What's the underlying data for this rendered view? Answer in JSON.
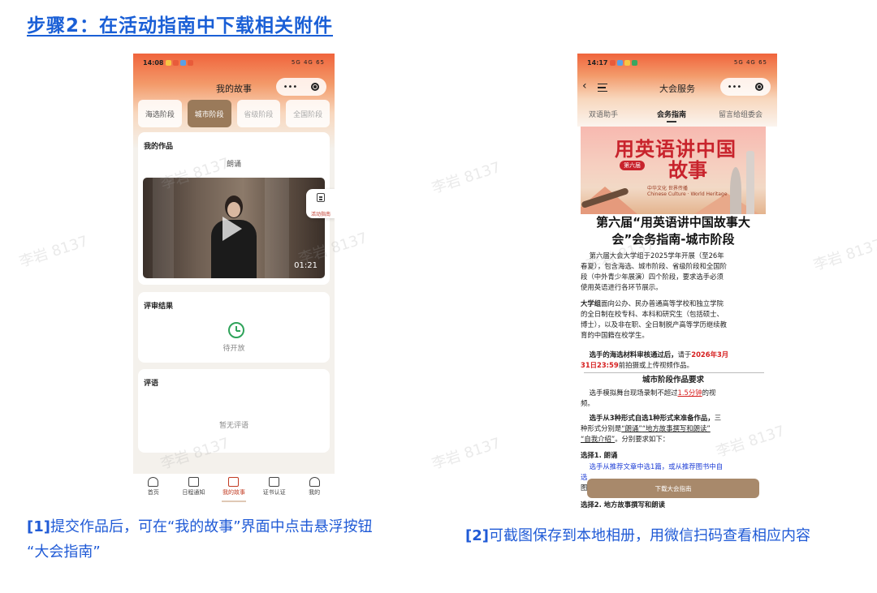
{
  "step_title": "步骤2：在活动指南中下载相关附件",
  "watermark": "李岩 8137",
  "phone1": {
    "time": "14:08",
    "status_right": "5G 4G 65",
    "nav_title": "我的故事",
    "capsule_more": "•••",
    "stage_tabs": [
      "海选阶段",
      "城市阶段",
      "省级阶段",
      "全国阶段"
    ],
    "active_stage": "城市阶段",
    "works_title": "我的作品",
    "work_type": "朗诵",
    "video_duration": "01:21",
    "float_button_label": "活动指南",
    "review_title": "评审结果",
    "review_status": "待开放",
    "comment_title": "评语",
    "comment_empty": "暂无评语",
    "bottom_nav": [
      "首页",
      "日程通知",
      "我的故事",
      "证书认证",
      "我的"
    ],
    "active_nav": "我的故事"
  },
  "phone2": {
    "time": "14:17",
    "status_right": "5G 4G 65",
    "nav_title": "大会服务",
    "capsule_more": "•••",
    "top_tabs": [
      "双语助手",
      "会务指南",
      "留言给组委会"
    ],
    "active_tab": "会务指南",
    "banner": {
      "line1": "用英语讲中国",
      "line2": "故事",
      "ribbon": "第六届",
      "subtitle": "中华文化 世界传播",
      "subtitle_en": "Chinese Culture · World Heritage"
    },
    "doc": {
      "title_line1": "第六届“用英语讲中国故事大",
      "title_line2": "会”会务指南-城市阶段",
      "para1": [
        "第六届大会大学组于2025学年开展（至26年",
        "春夏），包含海选、城市阶段、省级阶段和全国阶",
        "段（中外青少年展演）四个阶段，要求选手必须",
        "使用英语进行各环节展示。"
      ],
      "para2_bold": "大学组",
      "para2": [
        "面向公办、民办普通高等学校和独立学院",
        "的全日制在校专科、本科和研究生（包括硕士、",
        "博士），以及非在职、全日制脱产高等学历继续教",
        "育的中国籍在校学生。"
      ],
      "para3_a": "选手的海选材料审核通过后，",
      "para3_b": "请于",
      "para3_red1": "2026年3月",
      "para3_red2": "31日23:59",
      "para3_c": "前拍摄或上传视频作品。",
      "section1": "城市阶段作品要求",
      "para4_a": "选手模拟舞台现场录制不超过",
      "para4_ul": "1.5分钟",
      "para4_b": "的视",
      "para4_c": "频。",
      "para5_bold": "选手从3种形式自选1种形式来准备作品，",
      "para5_a": "三",
      "para5_b": "种形式分别是",
      "para5_opt1": "“朗诵”",
      "para5_opt2": "“地方故事撰写和朗读”",
      "para5_opt3": "“自我介绍”",
      "para5_c": "。分别要求如下：",
      "choice1": "选择1. 朗诵",
      "choice1_text": "选手从推荐文章中选1篇，或从推荐图书中自",
      "choice1_text2": "选",
      "choice1_text3": "图",
      "choice2": "选择2. 地方故事撰写和朗读"
    },
    "download_button": "下载大会指南"
  },
  "caption1": {
    "tag": "[1]",
    "text_line1": "提交作品后，可在“我的故事”界面中点击悬浮按钮",
    "text_line2": "“大会指南”"
  },
  "caption2": {
    "tag": "[2]",
    "text": "可截图保存到本地相册，用微信扫码查看相应内容"
  }
}
